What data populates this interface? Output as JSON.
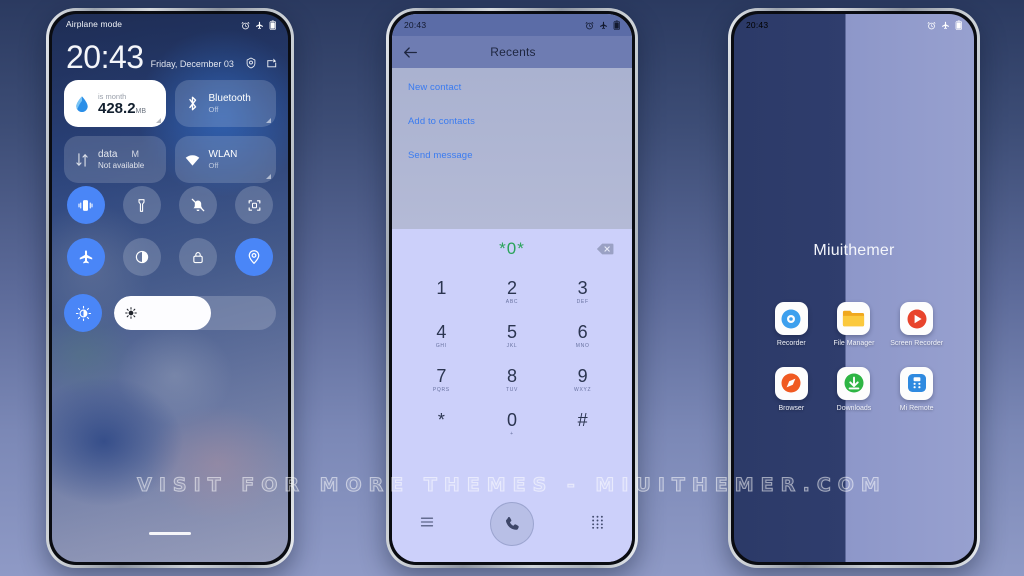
{
  "watermark": "VISIT FOR MORE THEMES - MIUITHEMER.COM",
  "colors": {
    "accent_blue": "#4a86f7",
    "link_blue": "#3a7bf0",
    "dial_green": "#2aa35a",
    "page_bg_top": "#2b3a60",
    "page_bg_bottom": "#8f9ac6"
  },
  "lock_screen": {
    "statusbar": {
      "time": "",
      "icons": [
        "alarm-icon",
        "airplane-icon",
        "battery-icon"
      ]
    },
    "airplane_label": "Airplane mode",
    "clock": {
      "time": "20:43",
      "date": "Friday, December 03"
    },
    "clock_icons": [
      "settings-gear-icon",
      "edit-icon"
    ],
    "tiles": [
      {
        "name": "data-usage",
        "style": "light",
        "title": "is month",
        "value": "428.2",
        "unit": "MB",
        "icon": "water-drop-icon"
      },
      {
        "name": "bluetooth",
        "style": "glass",
        "title": "Bluetooth",
        "sub": "Off",
        "icon": "bluetooth-icon"
      },
      {
        "name": "mobile-data",
        "style": "glass",
        "title": "data",
        "title_extra": "M",
        "sub": "Not available",
        "icon": "data-transfer-icon"
      },
      {
        "name": "wlan",
        "style": "glass",
        "title": "WLAN",
        "sub": "Off",
        "icon": "wifi-icon"
      }
    ],
    "toggles": [
      {
        "name": "vibrate",
        "icon": "vibrate-icon",
        "on": true
      },
      {
        "name": "flashlight",
        "icon": "flashlight-icon",
        "on": false
      },
      {
        "name": "silent",
        "icon": "bell-off-icon",
        "on": false
      },
      {
        "name": "cast",
        "icon": "cast-screen-icon",
        "on": false
      },
      {
        "name": "airplane-mode",
        "icon": "airplane-icon",
        "on": true
      },
      {
        "name": "dark-mode",
        "icon": "contrast-icon",
        "on": false
      },
      {
        "name": "screen-lock",
        "icon": "lock-icon",
        "on": false
      },
      {
        "name": "location",
        "icon": "location-pin-icon",
        "on": true
      }
    ],
    "brightness": {
      "auto_icon": "auto-brightness-icon",
      "auto_on": true,
      "slider_icon": "sun-icon",
      "level_percent": 60
    }
  },
  "dialer_screen": {
    "statusbar": {
      "time": "20:43",
      "icons": [
        "alarm-icon",
        "airplane-icon",
        "battery-icon"
      ]
    },
    "header": {
      "title": "Recents",
      "back_icon": "back-arrow-icon"
    },
    "contact_actions": [
      "New contact",
      "Add to contacts",
      "Send message"
    ],
    "display": {
      "number": "*0*",
      "backspace_icon": "backspace-icon"
    },
    "keys": [
      {
        "num": "1",
        "sub": ""
      },
      {
        "num": "2",
        "sub": "ABC"
      },
      {
        "num": "3",
        "sub": "DEF"
      },
      {
        "num": "4",
        "sub": "GHI"
      },
      {
        "num": "5",
        "sub": "JKL"
      },
      {
        "num": "6",
        "sub": "MNO"
      },
      {
        "num": "7",
        "sub": "PQRS"
      },
      {
        "num": "8",
        "sub": "TUV"
      },
      {
        "num": "9",
        "sub": "WXYZ"
      },
      {
        "num": "*",
        "sub": ""
      },
      {
        "num": "0",
        "sub": "+"
      },
      {
        "num": "#",
        "sub": ""
      }
    ],
    "actions": {
      "menu_icon": "menu-lines-icon",
      "call_icon": "phone-handset-icon",
      "keypad_icon": "dialpad-icon"
    }
  },
  "home_screen": {
    "statusbar": {
      "time": "20:43",
      "icons": [
        "alarm-icon",
        "airplane-icon",
        "battery-icon"
      ]
    },
    "folder_title": "Miuithemer",
    "apps": [
      {
        "label": "Recorder",
        "icon": "recorder-icon",
        "bg": "#ffffff",
        "accent": "#3da0ee"
      },
      {
        "label": "File Manager",
        "icon": "folder-icon",
        "bg": "#ffffff",
        "accent": "#f5c022"
      },
      {
        "label": "Screen Recorder",
        "icon": "screen-recorder-icon",
        "bg": "#ffffff",
        "accent": "#e8442c"
      },
      {
        "label": "Browser",
        "icon": "compass-icon",
        "bg": "#ffffff",
        "accent": "#f05a22"
      },
      {
        "label": "Downloads",
        "icon": "download-icon",
        "bg": "#ffffff",
        "accent": "#2eb544"
      },
      {
        "label": "Mi Remote",
        "icon": "remote-icon",
        "bg": "#ffffff",
        "accent": "#2f8ae0"
      }
    ]
  }
}
